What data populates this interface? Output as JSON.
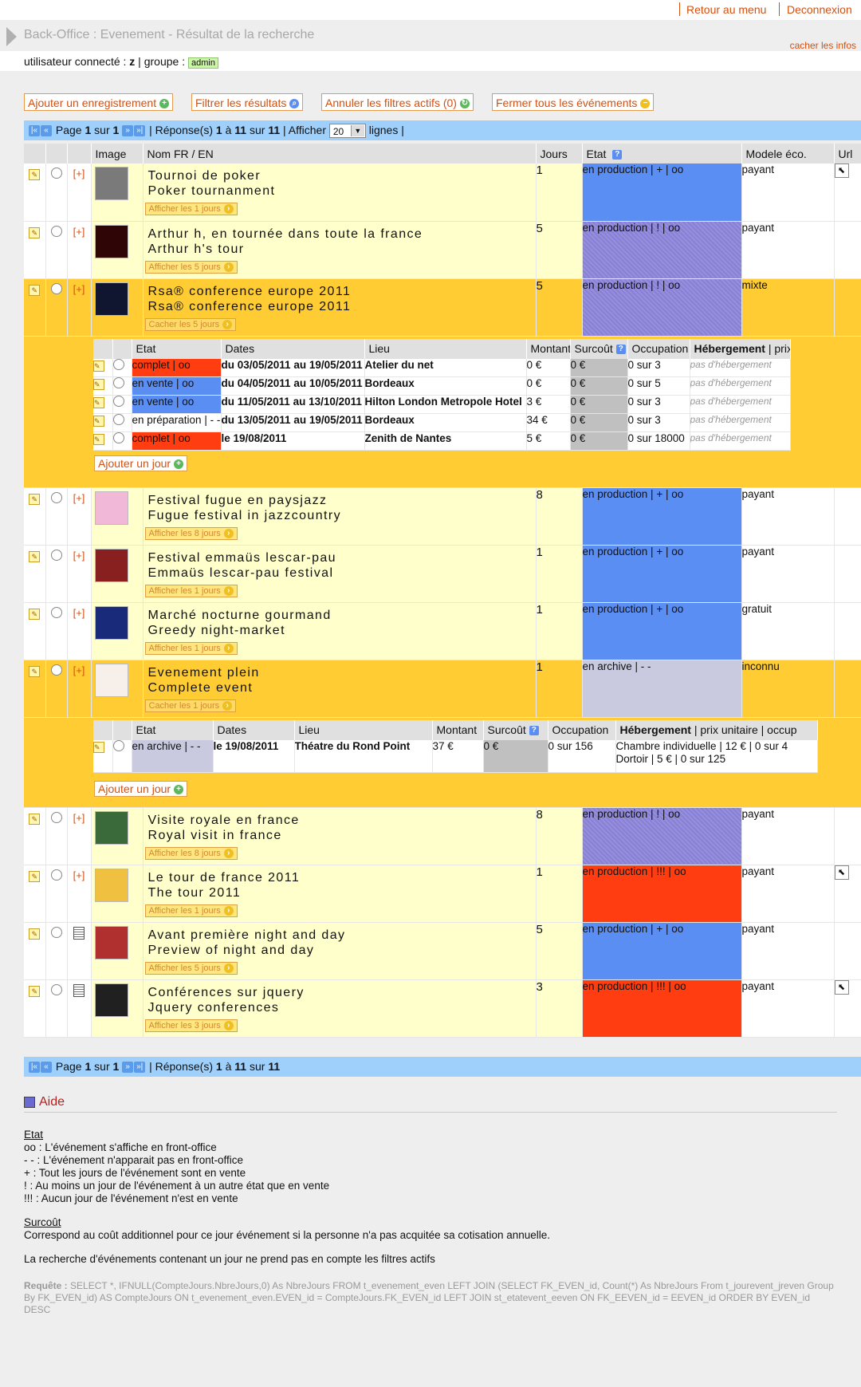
{
  "top": {
    "menu": "Retour au menu",
    "logout": "Deconnexion"
  },
  "title": {
    "text": "Back-Office : Evenement - Résultat de la recherche",
    "hide": "cacher les infos"
  },
  "user": {
    "label": "utilisateur connecté : ",
    "name": "z",
    "group_label": " | groupe : ",
    "group": "admin"
  },
  "actions": {
    "add": "Ajouter un enregistrement",
    "filter": "Filtrer les résultats",
    "cancel": "Annuler les filtres actifs (0)",
    "close": "Fermer tous les événements"
  },
  "pager": {
    "page_label": "Page",
    "page": "1",
    "of": "sur",
    "total": "1",
    "responses": "| Réponse(s)",
    "from": "1",
    "to_label": "à",
    "to": "11",
    "count_of": "sur",
    "count": "11",
    "show": "| Afficher",
    "lines": "20",
    "lines_label": "lignes |"
  },
  "columns": {
    "image": "Image",
    "name": "Nom FR / EN",
    "days": "Jours",
    "state": "Etat",
    "model": "Modele éco.",
    "url": "Url"
  },
  "events": [
    {
      "fr": "Tournoi de poker",
      "en": "Poker tournanment",
      "days": "1",
      "state": "en production | + | oo",
      "model": "payant",
      "btn": "Afficher les 1 jours",
      "plus": "[+]"
    },
    {
      "fr": "Arthur h, en tournée dans toute la france",
      "en": "Arthur h's tour",
      "days": "5",
      "state": "en production | ! | oo",
      "model": "payant",
      "btn": "Afficher les 5 jours",
      "plus": "[+]"
    },
    {
      "fr": "Rsa® conference europe 2011",
      "en": "Rsa® conference europe 2011",
      "days": "5",
      "state": "en production | ! | oo",
      "model": "mixte",
      "btn": "Cacher les 5 jours",
      "plus": "[+]"
    },
    {
      "fr": "Festival fugue en paysjazz",
      "en": "Fugue festival in jazzcountry",
      "days": "8",
      "state": "en production | + | oo",
      "model": "payant",
      "btn": "Afficher les 8 jours",
      "plus": "[+]"
    },
    {
      "fr": "Festival emmaüs lescar-pau",
      "en": "Emmaüs lescar-pau festival",
      "days": "1",
      "state": "en production | + | oo",
      "model": "payant",
      "btn": "Afficher les 1 jours",
      "plus": "[+]"
    },
    {
      "fr": "Marché nocturne gourmand",
      "en": "Greedy night-market",
      "days": "1",
      "state": "en production | + | oo",
      "model": "gratuit",
      "btn": "Afficher les 1 jours",
      "plus": "[+]"
    },
    {
      "fr": "Evenement plein",
      "en": "Complete event",
      "days": "1",
      "state": "en archive | - -",
      "model": "inconnu",
      "btn": "Cacher les 1 jours",
      "plus": "[+]"
    },
    {
      "fr": "Visite royale en france",
      "en": "Royal visit in france",
      "days": "8",
      "state": "en production | ! | oo",
      "model": "payant",
      "btn": "Afficher les 8 jours",
      "plus": "[+]"
    },
    {
      "fr": "Le tour de france 2011",
      "en": "The tour 2011",
      "days": "1",
      "state": "en production | !!! | oo",
      "model": "payant",
      "btn": "Afficher les 1 jours",
      "plus": "[+]"
    },
    {
      "fr": "Avant première night and day",
      "en": "Preview of night and day",
      "days": "5",
      "state": "en production | + | oo",
      "model": "payant",
      "btn": "Afficher les 5 jours",
      "plus": ""
    },
    {
      "fr": "Conférences sur jquery",
      "en": "Jquery conferences",
      "days": "3",
      "state": "en production | !!! | oo",
      "model": "payant",
      "btn": "Afficher les 3 jours",
      "plus": ""
    }
  ],
  "sub_columns": {
    "state": "Etat",
    "dates": "Dates",
    "place": "Lieu",
    "amount": "Montant",
    "extra": "Surcoût",
    "occ": "Occupation",
    "heb": "Hébergement",
    "heb2": " | prix unitaire | occup"
  },
  "rsa_days": [
    {
      "state": "complet | oo",
      "dates": "du 03/05/2011 au 19/05/2011",
      "place": "Atelier du net",
      "amount": "0 €",
      "extra": "0 €",
      "occ": "0 sur 3",
      "heb": "pas d'hébergement"
    },
    {
      "state": "en vente | oo",
      "dates": "du 04/05/2011 au 10/05/2011",
      "place": "Bordeaux",
      "amount": "0 €",
      "extra": "0 €",
      "occ": "0 sur 5",
      "heb": "pas d'hébergement"
    },
    {
      "state": "en vente | oo",
      "dates": "du 11/05/2011 au 13/10/2011",
      "place": "Hilton London Metropole Hotel",
      "amount": "3 €",
      "extra": "0 €",
      "occ": "0 sur 3",
      "heb": "pas d'hébergement"
    },
    {
      "state": "en préparation | - -",
      "dates": "du 13/05/2011 au 19/05/2011",
      "place": "Bordeaux",
      "amount": "34 €",
      "extra": "0 €",
      "occ": "0 sur 3",
      "heb": "pas d'hébergement"
    },
    {
      "state": "complet | oo",
      "dates": "le 19/08/2011",
      "place": "Zenith de Nantes",
      "amount": "5 €",
      "extra": "0 €",
      "occ": "0 sur 18000",
      "heb": "pas d'hébergement"
    }
  ],
  "full_days": [
    {
      "state": "en archive | - -",
      "dates": "le 19/08/2011",
      "place": "Théatre du Rond Point",
      "amount": "37 €",
      "extra": "0 €",
      "occ": "0 sur 156",
      "heb1": "Chambre individuelle | 12 € | 0 sur 4",
      "heb2": "Dortoir | 5 € | 0 sur 125"
    }
  ],
  "add_day": "Ajouter un jour",
  "help": {
    "title": "Aide",
    "state_title": "Etat",
    "state_lines": [
      "oo : L'événement s'affiche en front-office",
      "- - : L'événement n'apparait pas en front-office",
      "+ : Tout les jours de l'événement sont en vente",
      "! : Au moins un jour de l'événement à un autre état que en vente",
      "!!! : Aucun jour de l'événement n'est en vente"
    ],
    "extra_title": "Surcoût",
    "extra_text": "Correspond au coût additionnel pour ce jour événement si la personne n'a pas acquitée sa cotisation annuelle.",
    "note": "La recherche d'événements contenant un jour ne prend pas en compte les filtres actifs",
    "req_label": "Requête :",
    "req": "SELECT *, IFNULL(CompteJours.NbreJours,0) As NbreJours FROM t_evenement_even LEFT JOIN (SELECT FK_EVEN_id, Count(*) As NbreJours From t_jourevent_jreven Group By FK_EVEN_id) AS CompteJours ON t_evenement_even.EVEN_id = CompteJours.FK_EVEN_id LEFT JOIN st_etatevent_eeven ON FK_EEVEN_id = EEVEN_id ORDER BY EVEN_id DESC"
  },
  "colors": {
    "accent": "#d4500f",
    "row": "#ffffcc",
    "row_open": "#ffcc33",
    "prod_plus": "#5b8ef2",
    "prod_warn": "#8880d6",
    "prod_none": "#ff3d10",
    "archive": "#c9c9e0",
    "pager": "#9fd0fb"
  }
}
